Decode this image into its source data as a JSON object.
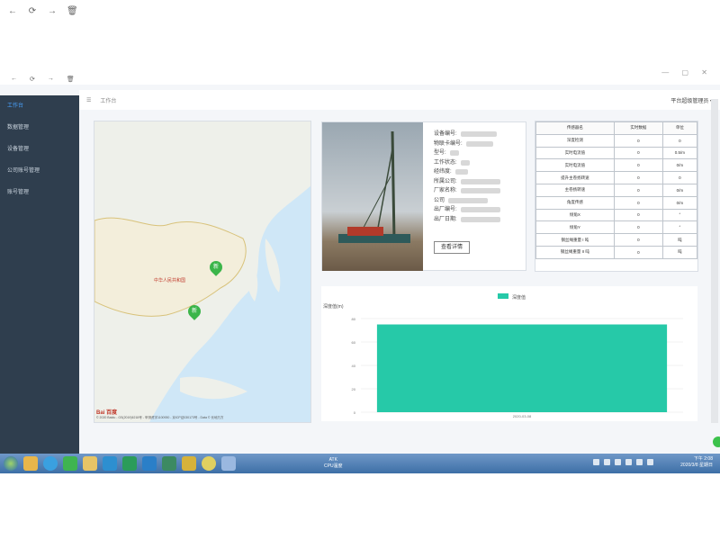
{
  "browser": {
    "back": "←",
    "refresh": "⟳",
    "forward": "→",
    "trash": "🗑"
  },
  "window_controls": "— ▢ ✕",
  "sidebar": {
    "items": [
      {
        "label": "工作台",
        "active": true
      },
      {
        "label": "数据管理"
      },
      {
        "label": "设备管理"
      },
      {
        "label": "公司账号管理"
      },
      {
        "label": "账号管理"
      }
    ]
  },
  "topbar": {
    "menu_icon": "☰",
    "breadcrumb": "工作台",
    "right_label": "平台超级管理员 ▾"
  },
  "map": {
    "country_label": "中华人民共和国",
    "markers": [
      "新",
      "新"
    ],
    "attribution": "© 2020 Baidu - GS(2019)5218号 - 甲测资字1100930 - 京ICP证030173号 - Data © 长地万方",
    "logo": "Bai 百度"
  },
  "device": {
    "labels": [
      "设备编号:",
      "物联卡编号:",
      "型号:",
      "工作状态:",
      "经纬度:",
      "所属公司:",
      "厂家名称:",
      "公司",
      "出厂编号:",
      "出厂日期:"
    ],
    "detail_button": "查看详情"
  },
  "table": {
    "headers": [
      "传感器名",
      "实时数据",
      "单位"
    ],
    "rows": [
      [
        "深度检测",
        "0",
        "0"
      ],
      [
        "实时电流值",
        "0",
        "0.5/m"
      ],
      [
        "实时电流值",
        "0",
        "0/m"
      ],
      [
        "提升主卷扬转速",
        "0",
        "0"
      ],
      [
        "主卷扬转速",
        "0",
        "0/m"
      ],
      [
        "角度传感",
        "0",
        "0/m"
      ],
      [
        "倾角X",
        "0",
        "°"
      ],
      [
        "倾角Y",
        "0",
        "°"
      ],
      [
        "钢丝绳重量 I 吨",
        "0",
        "吨"
      ],
      [
        "钢丝绳重量 II 吨",
        "0",
        "吨"
      ]
    ]
  },
  "chart_data": {
    "type": "bar",
    "title": "",
    "ylabel": "深度值(m)",
    "xlabel": "",
    "categories": [
      "2020-03-08"
    ],
    "series": [
      {
        "name": "深度值",
        "values": [
          75
        ]
      }
    ],
    "ylim": [
      0,
      80
    ],
    "yticks": [
      0,
      20,
      40,
      60,
      80
    ],
    "color": "#26c9a8",
    "legend_position": "top"
  },
  "taskbar": {
    "center_text": [
      "ATK",
      "CPU温度"
    ],
    "time": "下午 2:08",
    "date": "2020/3/8 星期日"
  },
  "colors": {
    "sidebar": "#2f3e4e",
    "accent": "#4aa3ff",
    "bar": "#26c9a8",
    "marker": "#3bb54a"
  }
}
